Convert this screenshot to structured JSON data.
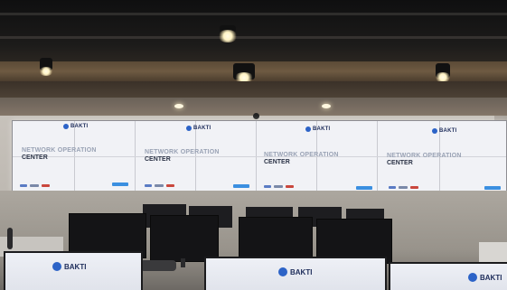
{
  "videowall": {
    "panels": [
      {
        "logo": "BAKTI",
        "line1": "NETWORK OPERATION",
        "line2": "CENTER"
      },
      {
        "logo": "BAKTI",
        "line1": "NETWORK OPERATION",
        "line2": "CENTER"
      },
      {
        "logo": "BAKTI",
        "line1": "NETWORK OPERATION",
        "line2": "CENTER"
      },
      {
        "logo": "BAKTI",
        "line1": "NETWORK OPERATION",
        "line2": "CENTER"
      }
    ]
  },
  "foreground": {
    "screens": [
      {
        "logo": "BAKTI"
      },
      {
        "logo": "BAKTI"
      },
      {
        "logo": "BAKTI"
      }
    ]
  },
  "colors": {
    "brand_blue": "#2c63c7",
    "brand_text": "#1d2c5a",
    "accent_button": "#3b8fe0"
  }
}
